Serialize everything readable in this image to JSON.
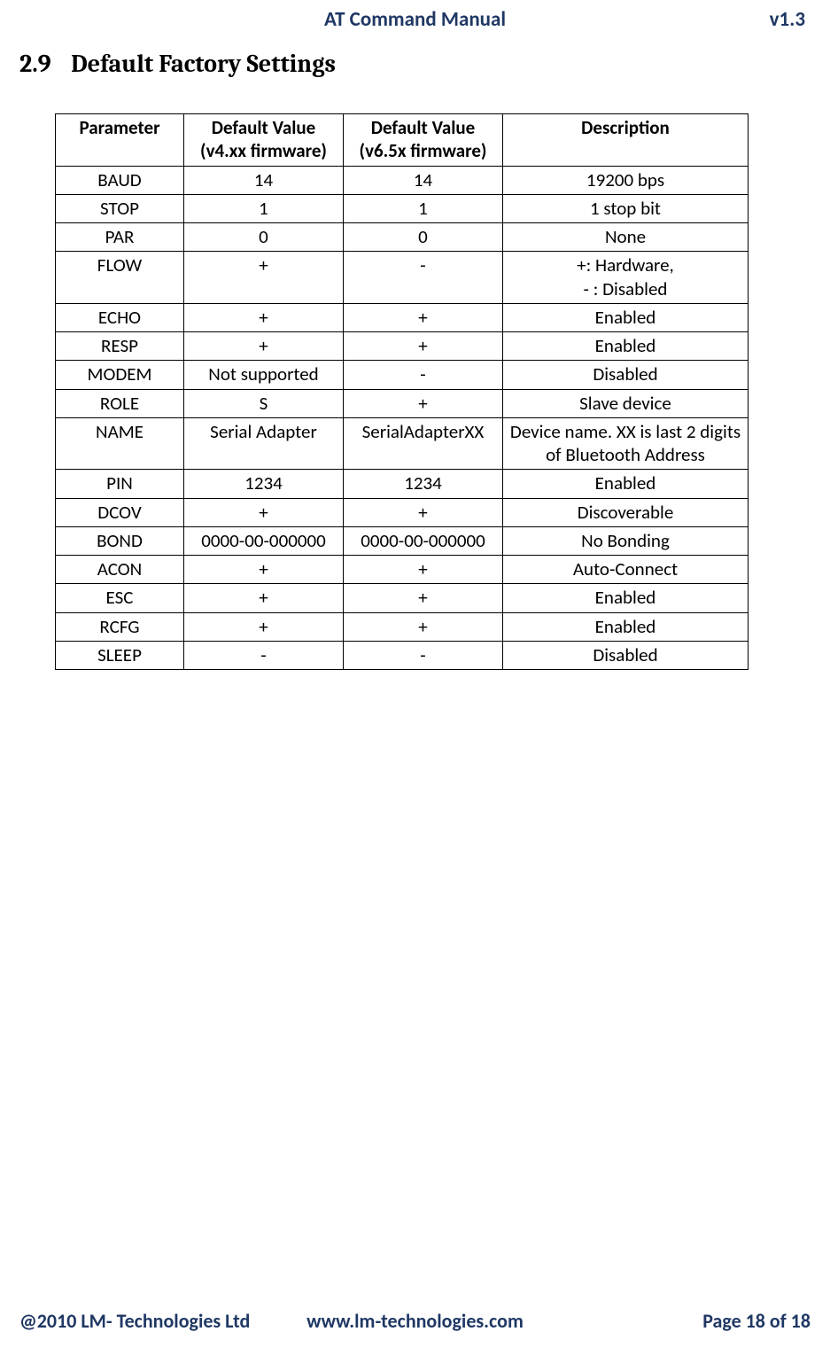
{
  "header": {
    "title": "AT Command Manual",
    "version": "v1.3"
  },
  "section": {
    "number": "2.9",
    "title": "Default Factory Settings"
  },
  "table": {
    "headers": {
      "parameter": "Parameter",
      "v4": "Default Value (v4.xx firmware)",
      "v6": "Default Value (v6.5x firmware)",
      "desc": "Description"
    },
    "rows": [
      {
        "parameter": "BAUD",
        "v4": "14",
        "v6": "14",
        "desc": "19200 bps"
      },
      {
        "parameter": "STOP",
        "v4": "1",
        "v6": "1",
        "desc": "1 stop bit"
      },
      {
        "parameter": "PAR",
        "v4": "0",
        "v6": "0",
        "desc": "None"
      },
      {
        "parameter": "FLOW",
        "v4": "+",
        "v6": "-",
        "desc": "+: Hardware,\n- : Disabled"
      },
      {
        "parameter": "ECHO",
        "v4": "+",
        "v6": "+",
        "desc": "Enabled"
      },
      {
        "parameter": "RESP",
        "v4": "+",
        "v6": "+",
        "desc": "Enabled"
      },
      {
        "parameter": "MODEM",
        "v4": "Not supported",
        "v6": "-",
        "desc": "Disabled"
      },
      {
        "parameter": "ROLE",
        "v4": "S",
        "v6": "+",
        "desc": "Slave device"
      },
      {
        "parameter": "NAME",
        "v4": "Serial Adapter",
        "v6": "SerialAdapterXX",
        "desc": "Device name. XX is last 2 digits of Bluetooth Address"
      },
      {
        "parameter": "PIN",
        "v4": "1234",
        "v6": "1234",
        "desc": "Enabled"
      },
      {
        "parameter": "DCOV",
        "v4": "+",
        "v6": "+",
        "desc": "Discoverable"
      },
      {
        "parameter": "BOND",
        "v4": "0000-00-000000",
        "v6": "0000-00-000000",
        "desc": "No Bonding"
      },
      {
        "parameter": "ACON",
        "v4": "+",
        "v6": "+",
        "desc": "Auto-Connect"
      },
      {
        "parameter": "ESC",
        "v4": "+",
        "v6": "+",
        "desc": "Enabled"
      },
      {
        "parameter": "RCFG",
        "v4": "+",
        "v6": "+",
        "desc": "Enabled"
      },
      {
        "parameter": "SLEEP",
        "v4": "-",
        "v6": "-",
        "desc": "Disabled"
      }
    ]
  },
  "footer": {
    "left": "@2010 LM- Technologies Ltd",
    "center": "www.lm-technologies.com",
    "right": "Page 18 of 18"
  }
}
